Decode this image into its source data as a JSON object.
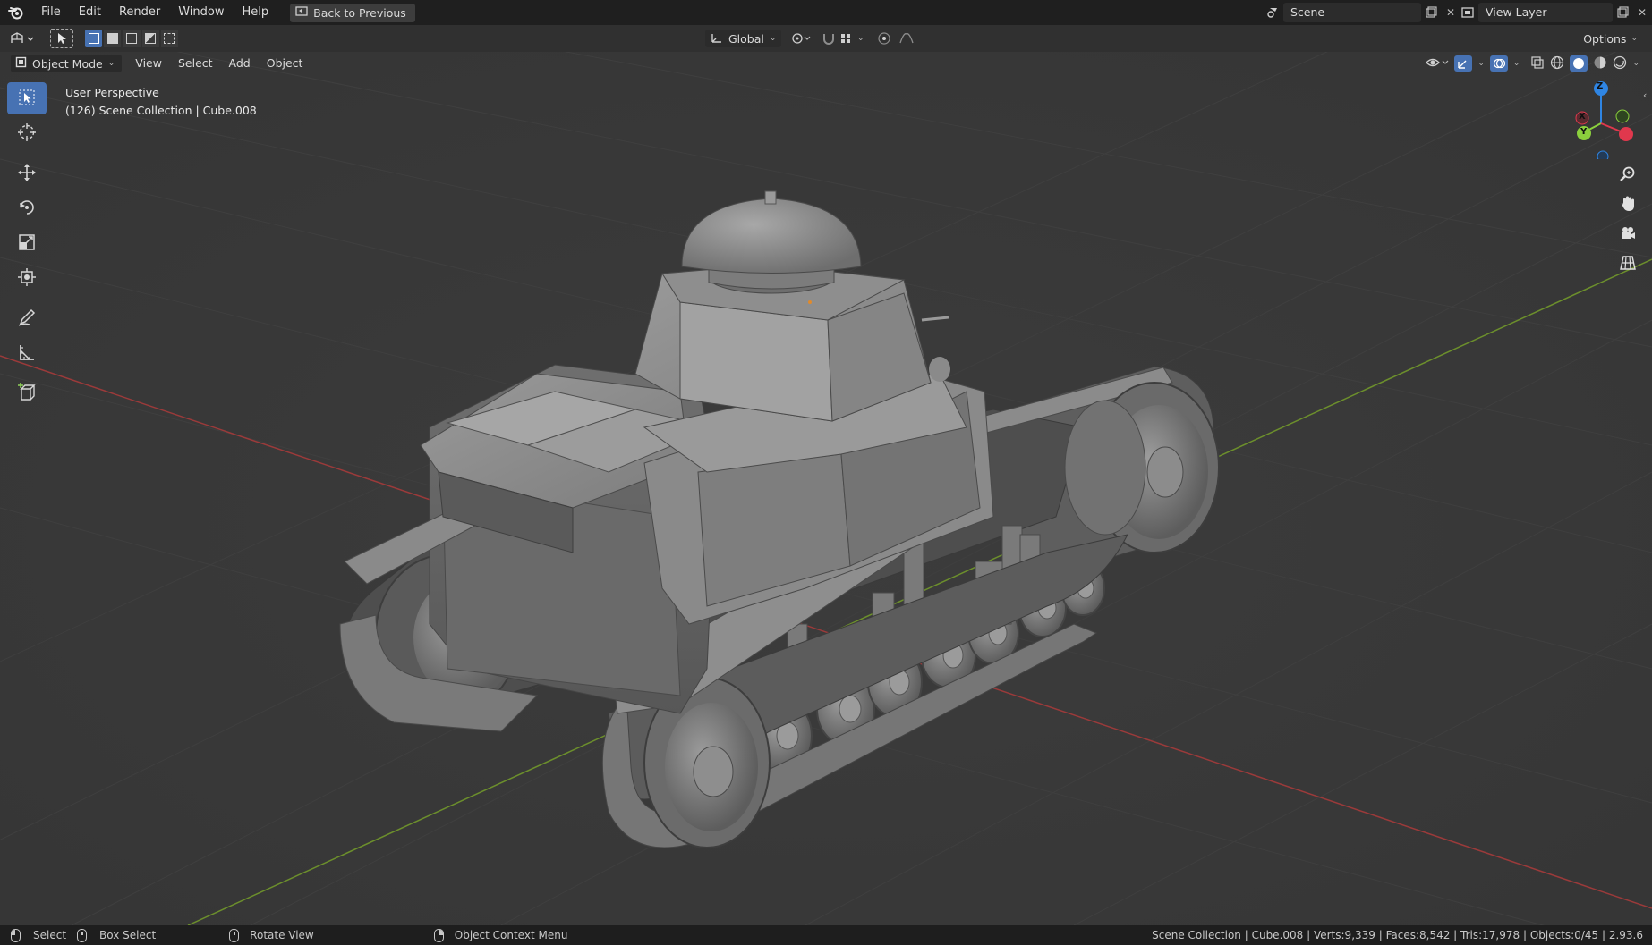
{
  "topbar": {
    "menu": [
      "File",
      "Edit",
      "Render",
      "Window",
      "Help"
    ],
    "back_label": "Back to Previous",
    "scene_name": "Scene",
    "view_layer": "View Layer"
  },
  "toolheader": {
    "orientation": "Global",
    "options_label": "Options"
  },
  "viewport_header": {
    "mode": "Object Mode",
    "menus": [
      "View",
      "Select",
      "Add",
      "Object"
    ]
  },
  "viewport_info": {
    "perspective": "User Perspective",
    "collection": "(126) Scene Collection | Cube.008"
  },
  "left_tools": [
    {
      "name": "select-box-tool",
      "icon": "cursor-arrow-icon",
      "active": true
    },
    {
      "name": "cursor-tool",
      "icon": "crosshair-icon",
      "active": false
    },
    {
      "name": "move-tool",
      "icon": "move-arrows-icon",
      "active": false
    },
    {
      "name": "rotate-tool",
      "icon": "rotate-icon",
      "active": false
    },
    {
      "name": "scale-tool",
      "icon": "scale-icon",
      "active": false
    },
    {
      "name": "transform-tool",
      "icon": "transform-icon",
      "active": false
    },
    {
      "name": "annotate-tool",
      "icon": "pencil-icon",
      "active": false
    },
    {
      "name": "measure-tool",
      "icon": "ruler-icon",
      "active": false
    },
    {
      "name": "add-cube-tool",
      "icon": "add-cube-icon",
      "active": false
    }
  ],
  "nav_gizmo": {
    "x_label": "X",
    "y_label": "Y",
    "z_label": "Z",
    "x_color": "#e0384d",
    "y_color": "#8bd03d",
    "z_color": "#2f85e3"
  },
  "statusbar": {
    "select": "Select",
    "box_select": "Box Select",
    "rotate_view": "Rotate View",
    "context_menu": "Object Context Menu",
    "stats": "Scene Collection | Cube.008 | Verts:9,339 | Faces:8,542 | Tris:17,978 | Objects:0/45 | 2.93.6"
  },
  "colors": {
    "viewport_bg": "#393939",
    "accent": "#4772b3",
    "x_axis": "#a23a3a",
    "y_axis": "#6a8f2c"
  }
}
